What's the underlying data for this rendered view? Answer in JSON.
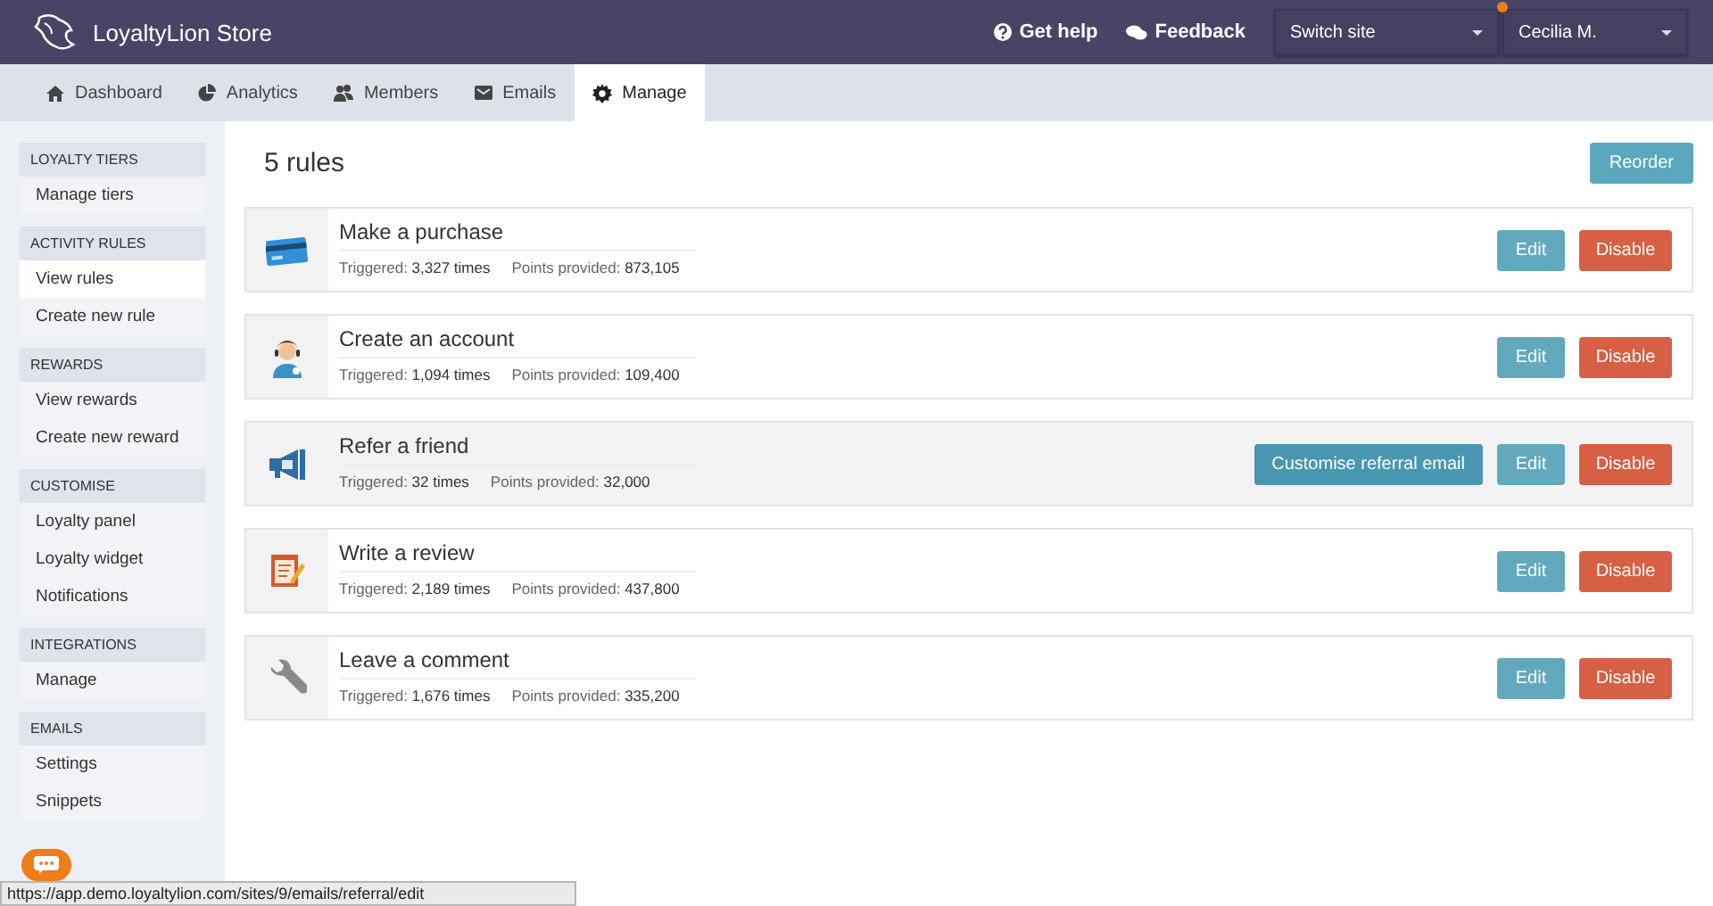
{
  "topbar": {
    "brand": "LoyaltyLion Store",
    "links": [
      {
        "kind": "help",
        "label": "Get help"
      },
      {
        "kind": "feedback",
        "label": "Feedback"
      }
    ],
    "site_select": {
      "value": "Switch site"
    },
    "user_select": {
      "value": "Cecilia M.",
      "notification": true
    }
  },
  "tabs": [
    {
      "kind": "home",
      "label": "Dashboard",
      "selected": false
    },
    {
      "kind": "chart",
      "label": "Analytics",
      "selected": false
    },
    {
      "kind": "people",
      "label": "Members",
      "selected": false
    },
    {
      "kind": "mail",
      "label": "Emails",
      "selected": false
    },
    {
      "kind": "gear",
      "label": "Manage",
      "selected": true
    }
  ],
  "sidebar": [
    {
      "heading": "LOYALTY TIERS",
      "items": [
        {
          "label": "Manage tiers",
          "selected": false
        }
      ]
    },
    {
      "heading": "ACTIVITY RULES",
      "items": [
        {
          "label": "View rules",
          "selected": true
        },
        {
          "label": "Create new rule",
          "selected": false
        }
      ]
    },
    {
      "heading": "REWARDS",
      "items": [
        {
          "label": "View rewards",
          "selected": false
        },
        {
          "label": "Create new reward",
          "selected": false
        }
      ]
    },
    {
      "heading": "CUSTOMISE",
      "items": [
        {
          "label": "Loyalty panel",
          "selected": false
        },
        {
          "label": "Loyalty widget",
          "selected": false
        },
        {
          "label": "Notifications",
          "selected": false
        }
      ]
    },
    {
      "heading": "INTEGRATIONS",
      "items": [
        {
          "label": "Manage",
          "selected": false
        }
      ]
    },
    {
      "heading": "EMAILS",
      "items": [
        {
          "label": "Settings",
          "selected": false
        },
        {
          "label": "Snippets",
          "selected": false
        }
      ]
    }
  ],
  "page": {
    "title": "5 rules",
    "reorder_button": "Reorder"
  },
  "rules": [
    {
      "kind": "card",
      "name": "Make a purchase",
      "triggered_label": "Triggered:",
      "triggered": "3,327 times",
      "points_label": "Points provided:",
      "points": "873,105",
      "highlighted": false,
      "buttons": [
        "Edit",
        "Disable"
      ]
    },
    {
      "kind": "person",
      "name": "Create an account",
      "triggered_label": "Triggered:",
      "triggered": "1,094 times",
      "points_label": "Points provided:",
      "points": "109,400",
      "highlighted": false,
      "buttons": [
        "Edit",
        "Disable"
      ]
    },
    {
      "kind": "megaphone",
      "name": "Refer a friend",
      "triggered_label": "Triggered:",
      "triggered": "32 times",
      "points_label": "Points provided:",
      "points": "32,000",
      "highlighted": true,
      "extra_button": "Customise referral email",
      "buttons": [
        "Edit",
        "Disable"
      ]
    },
    {
      "kind": "notepad",
      "name": "Write a review",
      "triggered_label": "Triggered:",
      "triggered": "2,189 times",
      "points_label": "Points provided:",
      "points": "437,800",
      "highlighted": false,
      "buttons": [
        "Edit",
        "Disable"
      ]
    },
    {
      "kind": "wrench",
      "name": "Leave a comment",
      "triggered_label": "Triggered:",
      "triggered": "1,676 times",
      "points_label": "Points provided:",
      "points": "335,200",
      "highlighted": false,
      "buttons": [
        "Edit",
        "Disable"
      ]
    }
  ],
  "status_bar": {
    "url": "https://app.demo.loyaltylion.com/sites/9/emails/referral/edit"
  }
}
